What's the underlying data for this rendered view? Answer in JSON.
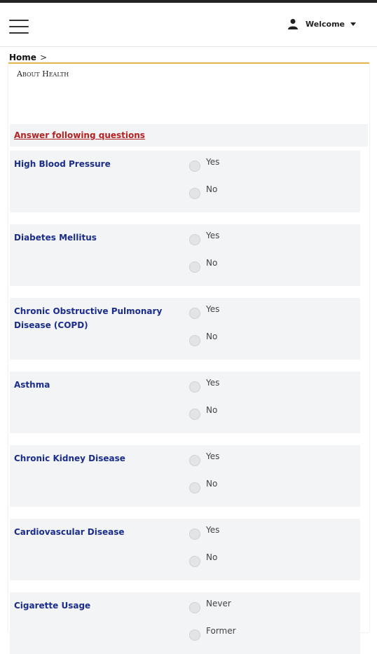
{
  "header": {
    "welcome_label": "Welcome",
    "menu_icon": "hamburger-icon",
    "user_icon": "user-icon",
    "caret_icon": "caret-down-icon"
  },
  "breadcrumb": {
    "home": "Home",
    "separator": ">"
  },
  "panel": {
    "title": "About Health",
    "accent_color": "#e3b84c",
    "instructions": "Answer following questions"
  },
  "questions": [
    {
      "label": "High Blood Pressure",
      "options": [
        "Yes",
        "No"
      ]
    },
    {
      "label": "Diabetes Mellitus",
      "options": [
        "Yes",
        "No"
      ]
    },
    {
      "label": "Chronic Obstructive Pulmonary Disease (COPD)",
      "options": [
        "Yes",
        "No"
      ]
    },
    {
      "label": "Asthma",
      "options": [
        "Yes",
        "No"
      ]
    },
    {
      "label": "Chronic Kidney Disease",
      "options": [
        "Yes",
        "No"
      ]
    },
    {
      "label": "Cardiovascular Disease",
      "options": [
        "Yes",
        "No"
      ]
    },
    {
      "label": "Cigarette Usage",
      "options": [
        "Never",
        "Former"
      ]
    }
  ]
}
